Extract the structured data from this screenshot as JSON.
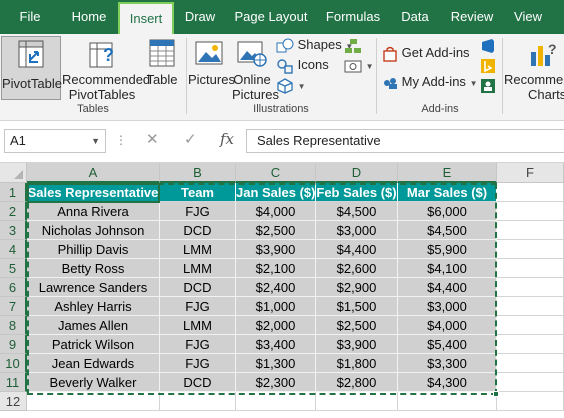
{
  "tabs": [
    {
      "label": "File"
    },
    {
      "label": "Home"
    },
    {
      "label": "Insert"
    },
    {
      "label": "Draw"
    },
    {
      "label": "Page Layout"
    },
    {
      "label": "Formulas"
    },
    {
      "label": "Data"
    },
    {
      "label": "Review"
    },
    {
      "label": "View"
    }
  ],
  "active_tab": "Insert",
  "ribbon": {
    "tables": {
      "pivottable": "PivotTable",
      "recommended_line1": "Recommended",
      "recommended_line2": "PivotTables",
      "table": "Table",
      "group_label": "Tables"
    },
    "illustrations": {
      "pictures": "Pictures",
      "online_line1": "Online",
      "online_line2": "Pictures",
      "shapes": "Shapes",
      "icons": "Icons",
      "group_label": "Illustrations"
    },
    "addins": {
      "get_addins": "Get Add-ins",
      "my_addins": "My Add-ins",
      "group_label": "Add-ins"
    },
    "charts": {
      "recommended_line1": "Recommen",
      "recommended_line2": "Charts"
    }
  },
  "formula_bar": {
    "name_box": "A1",
    "content": "Sales Representative",
    "fx": "fx",
    "cancel": "✕",
    "enter": "✓",
    "dots": "⋮"
  },
  "columns": [
    "A",
    "B",
    "C",
    "D",
    "E",
    "F"
  ],
  "rows": [
    "1",
    "2",
    "3",
    "4",
    "5",
    "6",
    "7",
    "8",
    "9",
    "10",
    "11",
    "12"
  ],
  "table": {
    "headers": [
      "Sales Representative",
      "Team",
      "Jan Sales ($)",
      "Feb Sales ($)",
      "Mar Sales ($)"
    ],
    "rows": [
      [
        "Anna Rivera",
        "FJG",
        "$4,000",
        "$4,500",
        "$6,000"
      ],
      [
        "Nicholas Johnson",
        "DCD",
        "$2,500",
        "$3,000",
        "$4,500"
      ],
      [
        "Phillip Davis",
        "LMM",
        "$3,900",
        "$4,400",
        "$5,900"
      ],
      [
        "Betty Ross",
        "LMM",
        "$2,100",
        "$2,600",
        "$4,100"
      ],
      [
        "Lawrence Sanders",
        "DCD",
        "$2,400",
        "$2,900",
        "$4,400"
      ],
      [
        "Ashley Harris",
        "FJG",
        "$1,000",
        "$1,500",
        "$3,000"
      ],
      [
        "James Allen",
        "LMM",
        "$2,000",
        "$2,500",
        "$4,000"
      ],
      [
        "Patrick Wilson",
        "FJG",
        "$3,400",
        "$3,900",
        "$5,400"
      ],
      [
        "Jean Edwards",
        "FJG",
        "$1,300",
        "$1,800",
        "$3,300"
      ],
      [
        "Beverly Walker",
        "DCD",
        "$2,300",
        "$2,800",
        "$4,300"
      ]
    ]
  },
  "colors": {
    "accent": "#217346",
    "header_fill": "#009999",
    "data_fill": "#d0d0d0"
  }
}
